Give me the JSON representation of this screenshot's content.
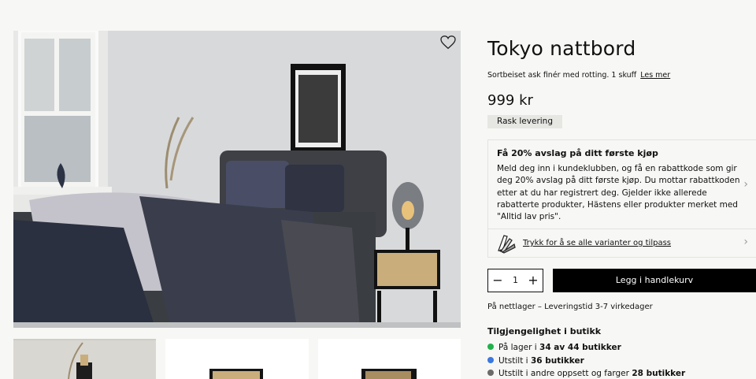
{
  "product": {
    "title": "Tokyo nattbord",
    "description": "Sortbeiset ask finér med rotting. 1 skuff",
    "read_more": "Les mer",
    "price": "999 kr",
    "badge": "Rask levering"
  },
  "promo": {
    "title": "Få 20% avslag på ditt første kjøp",
    "text": "Meld deg inn i kundeklubben, og få en rabattkode som gir deg 20% avslag på ditt første kjøp. Du mottar rabattkoden etter at du har registrert deg. Gjelder ikke allerede rabatterte produkter, Hästens eller produkter merket med \"Alltid lav pris\"."
  },
  "variants": {
    "label": "Trykk for å se alle varianter og tilpass"
  },
  "cart": {
    "minus": "−",
    "quantity": "1",
    "plus": "+",
    "add_label": "Legg i handlekurv"
  },
  "delivery": "På nettlager – Leveringstid 3-7 virkedager",
  "availability": {
    "title": "Tilgjengelighet i butikk",
    "rows": [
      {
        "prefix": "På lager i ",
        "value": "34 av 44 butikker",
        "color": "#22b04b"
      },
      {
        "prefix": "Utstilt i ",
        "value": "36 butikker",
        "color": "#3b78e0"
      },
      {
        "prefix": "Utstilt i andre oppsett og farger ",
        "value": "28 butikker",
        "color": "#6b6b6b"
      }
    ]
  },
  "icons": {
    "wishlist": "heart-icon",
    "promo_chevron": "chevron-right-icon",
    "variants": "swatch-fan-icon"
  }
}
